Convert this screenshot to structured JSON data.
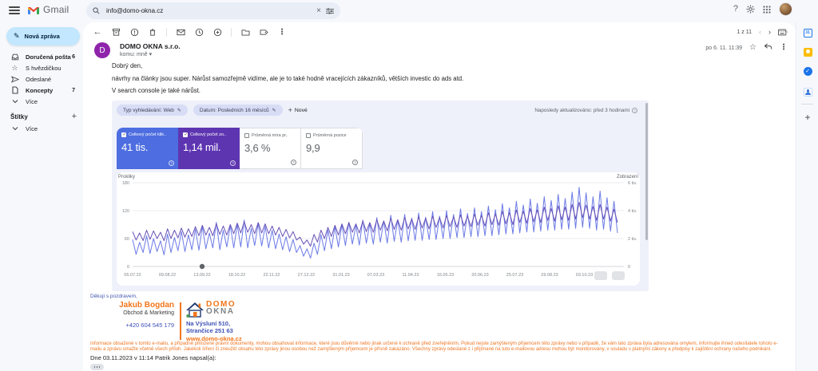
{
  "topbar": {
    "search_value": "info@domo-okna.cz"
  },
  "sidebar": {
    "compose_label": "Nová zpráva",
    "items": [
      {
        "label": "Doručená pošta",
        "count": "6"
      },
      {
        "label": "S hvězdičkou",
        "count": ""
      },
      {
        "label": "Odeslané",
        "count": ""
      },
      {
        "label": "Koncepty",
        "count": "7"
      },
      {
        "label": "Více",
        "count": ""
      }
    ],
    "labels_header": "Štítky",
    "labels_more": "Více"
  },
  "toolbar": {
    "pagination": "1 z 11"
  },
  "email": {
    "sender": "DOMO OKNA s.r.o.",
    "avatar_letter": "D",
    "to_label": "komu: mně",
    "date": "po 6. 11. 11:39",
    "greeting": "Dobrý den,",
    "para1": "návrhy na články jsou super. Nárůst samozřejmě vidíme, ale je to také hodně vracejících zákazníků, větších investic do ads atd.",
    "para2": "V search console je také nárůst."
  },
  "console": {
    "chips": [
      {
        "label": "Typ vyhledávání: Web"
      },
      {
        "label": "Datum: Posledních 16 měsíců"
      }
    ],
    "new_chip": "Nové",
    "last_updated": "Naposledy aktualizováno: před 3 hodinami",
    "cards": [
      {
        "label": "Celkový počet klik..",
        "value": "41 tis.",
        "checked": true,
        "bg": "#4d6de0"
      },
      {
        "label": "Celkový počet zo..",
        "value": "1,14 mil.",
        "checked": true,
        "bg": "#5e35b1"
      },
      {
        "label": "Průměrná míra pr..",
        "value": "3,6 %",
        "checked": false,
        "bg": "#ffffff"
      },
      {
        "label": "Průměrná pozice",
        "value": "9,9",
        "checked": false,
        "bg": "#ffffff"
      }
    ]
  },
  "chart_data": {
    "type": "line",
    "left_axis": {
      "label": "Prokliky",
      "ticks": [
        180,
        120,
        60,
        0
      ],
      "max": 180
    },
    "right_axis": {
      "label": "Zobrazení",
      "ticks": [
        "6 tis.",
        "4 tis.",
        "2 tis.",
        "0"
      ],
      "max": 6000
    },
    "x_labels": [
      "05.07.22",
      "09.08.22",
      "13.09.22",
      "18.10.22",
      "22.11.22",
      "27.12.22",
      "31.01.23",
      "07.03.23",
      "11.04.23",
      "16.05.23",
      "20.06.23",
      "25.07.23",
      "29.08.23",
      "03.10.23"
    ],
    "annotation": {
      "x_label": "13.09.22",
      "type": "dot"
    },
    "grid": true,
    "legend": "none",
    "series": [
      {
        "name": "Prokliky",
        "axis": "left",
        "color": "#6b7ae6",
        "values": [
          58,
          26,
          52,
          30,
          66,
          28,
          60,
          32,
          55,
          25,
          70,
          30,
          62,
          34,
          75,
          32,
          68,
          36,
          80,
          35,
          85,
          38,
          72,
          40,
          95,
          36,
          78,
          42,
          88,
          40,
          90,
          42,
          100,
          40,
          82,
          45,
          92,
          44,
          86,
          40,
          78,
          38,
          70,
          36,
          64,
          32,
          58,
          30,
          45,
          22,
          38,
          18,
          50,
          26,
          68,
          34,
          78,
          38,
          85,
          42,
          90,
          45,
          95,
          48,
          88,
          46,
          100,
          50,
          92,
          48,
          105,
          52,
          98,
          50,
          110,
          54,
          100,
          52,
          112,
          55,
          104,
          56,
          115,
          56,
          106,
          58,
          118,
          58,
          108,
          60,
          120,
          60,
          112,
          62,
          124,
          62,
          114,
          64,
          126,
          64,
          118,
          66,
          130,
          66,
          122,
          68,
          135,
          70,
          126,
          70,
          140,
          72,
          132,
          74,
          145,
          74,
          136,
          76,
          150,
          78,
          142,
          78,
          155,
          80,
          146,
          80,
          160,
          82,
          170,
          84,
          158,
          82,
          150,
          78,
          162,
          80,
          148,
          76,
          140,
          72
        ]
      },
      {
        "name": "Zobrazení",
        "axis": "right",
        "color": "#6750b5",
        "values": [
          2500,
          1900,
          2400,
          1850,
          2600,
          1950,
          2550,
          2000,
          2450,
          1850,
          2700,
          2000,
          2600,
          2050,
          2750,
          2100,
          2700,
          2150,
          2850,
          2200,
          2950,
          2250,
          2800,
          2200,
          3050,
          2300,
          2900,
          2250,
          3000,
          2350,
          3100,
          2400,
          3200,
          2450,
          3000,
          2350,
          3150,
          2400,
          3050,
          2350,
          2900,
          2250,
          2800,
          2150,
          2650,
          2050,
          2500,
          1900,
          2100,
          1600,
          1900,
          1450,
          2300,
          1750,
          2600,
          2000,
          2800,
          2150,
          2950,
          2250,
          3050,
          2350,
          3150,
          2450,
          3050,
          2400,
          3250,
          2500,
          3150,
          2450,
          3350,
          2600,
          3250,
          2550,
          3450,
          2650,
          3350,
          2600,
          3500,
          2700,
          3400,
          2650,
          3550,
          2750,
          3450,
          2700,
          3600,
          2800,
          3500,
          2750,
          3650,
          2850,
          3550,
          2800,
          3700,
          2900,
          3600,
          2850,
          3750,
          2950,
          3650,
          2900,
          3850,
          3000,
          3750,
          2950,
          3950,
          3050,
          3850,
          3000,
          4050,
          3150,
          3950,
          3100,
          4150,
          3200,
          4050,
          3150,
          4250,
          3300,
          4150,
          3250,
          4350,
          3350,
          4250,
          3300,
          4450,
          3400,
          4600,
          3500,
          4400,
          3400,
          4300,
          3300,
          4450,
          3400,
          4250,
          3250,
          4100,
          3150
        ]
      }
    ]
  },
  "signature": {
    "thanks": "Děkuji s pozdravem,",
    "name": "Jakub Bogdan",
    "role": "Obchod & Marketing",
    "phone": "+420 604 545 179",
    "logo_line1": "DOMO",
    "logo_line2": "OKNA",
    "address1": "Na Výsluní 510,",
    "address2": "Strančice 251 63",
    "website": "www.domo-okna.cz"
  },
  "footer": {
    "disclaimer": "Informace obsažené v tomto e-mailu, a případně přiložené právní dokumenty, mohou obsahovat informace, které jsou důvěrné nebo jinak určené k ochraně před zveřejněním. Pokud nejste zamýšleným příjemcem této zprávy nebo v případě, že vám tato zpráva byla adresována omylem, informujte ihned odesílatele tohoto e-mailu a zprávu smažte včetně všech příloh. Jakékoli šíření či zneužití obsahu této zprávy jinou osobou než zamýšleným příjemcem je přísně zakázáno. Všechny zprávy odeslané z i přijímané na tuto e-mailovou adresu mohou být monitorovány, v souladu s platnými zákony a předpisy k zajištění ochrany našeho podnikání.",
    "quote_line": "Dne 03.11.2023 v 11:14 Patrik Jones napsal(a):"
  }
}
